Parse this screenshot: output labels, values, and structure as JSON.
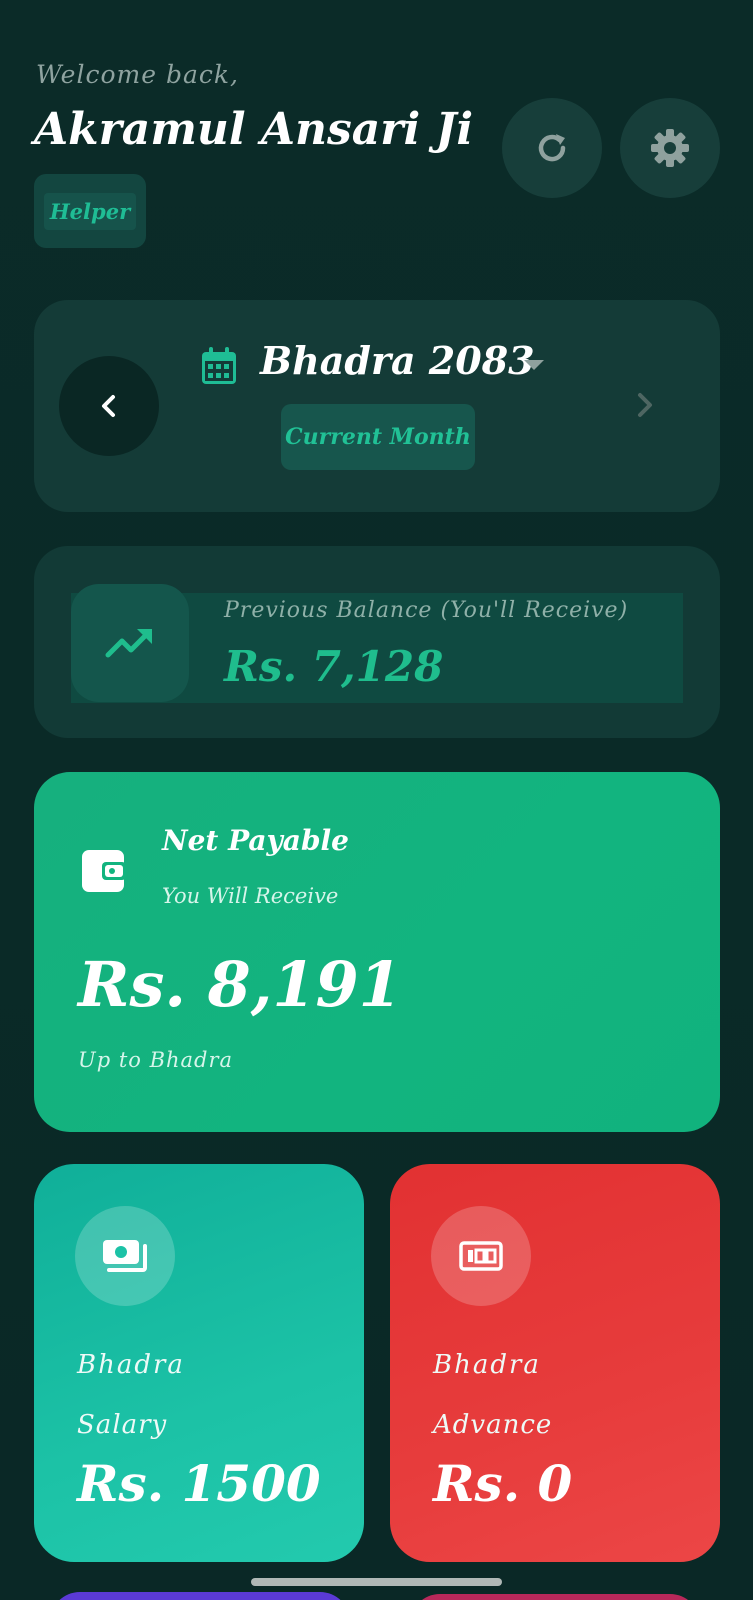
{
  "header": {
    "welcome": "Welcome back,",
    "user_name": "Akramul Ansari Ji",
    "role": "Helper",
    "refresh_icon": "refresh-icon",
    "settings_icon": "gear-icon"
  },
  "month_selector": {
    "title": "Bhadra 2083",
    "badge": "Current Month",
    "icons": [
      "chevron-left-icon",
      "calendar-icon",
      "caret-down-icon",
      "chevron-right-icon"
    ]
  },
  "previous_balance": {
    "label": "Previous Balance (You'll Receive)",
    "amount": "Rs. 7,128",
    "icon": "trending-up-icon",
    "color": "#1fbd8d"
  },
  "net_payable": {
    "title": "Net Payable",
    "subtitle": "You Will Receive",
    "amount": "Rs. 8,191",
    "note": "Up to Bhadra",
    "icon": "wallet-icon",
    "color": "#12b47f"
  },
  "salary": {
    "month": "Bhadra",
    "label": "Salary",
    "amount": "Rs. 1500",
    "icon": "money-icon",
    "color": "#1cc2a6"
  },
  "advance": {
    "month": "Bhadra",
    "label": "Advance",
    "amount": "Rs. 0",
    "icon": "banknote-icon",
    "color": "#e73c3c"
  }
}
